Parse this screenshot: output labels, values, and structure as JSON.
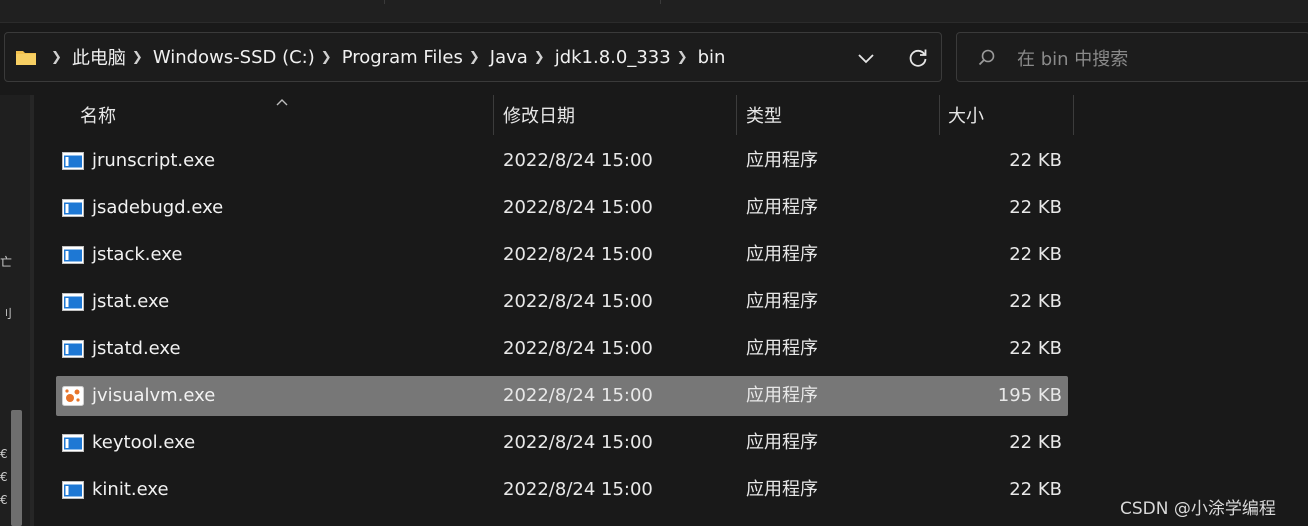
{
  "address_bar": {
    "folder_icon": "folder-icon",
    "breadcrumbs": [
      "此电脑",
      "Windows-SSD (C:)",
      "Program Files",
      "Java",
      "jdk1.8.0_333",
      "bin"
    ],
    "dropdown_icon": "chevron-down-icon",
    "refresh_icon": "refresh-icon"
  },
  "search": {
    "placeholder": "在 bin 中搜索",
    "value": "",
    "icon": "search-icon"
  },
  "columns": {
    "name": "名称",
    "date": "修改日期",
    "type": "类型",
    "size": "大小",
    "sort_indicator": "chevron-up-icon"
  },
  "files": [
    {
      "name": "jrunscript.exe",
      "date": "2022/8/24 15:00",
      "type": "应用程序",
      "size": "22 KB",
      "icon": "exe-window-icon",
      "selected": false
    },
    {
      "name": "jsadebugd.exe",
      "date": "2022/8/24 15:00",
      "type": "应用程序",
      "size": "22 KB",
      "icon": "exe-window-icon",
      "selected": false
    },
    {
      "name": "jstack.exe",
      "date": "2022/8/24 15:00",
      "type": "应用程序",
      "size": "22 KB",
      "icon": "exe-window-icon",
      "selected": false
    },
    {
      "name": "jstat.exe",
      "date": "2022/8/24 15:00",
      "type": "应用程序",
      "size": "22 KB",
      "icon": "exe-window-icon",
      "selected": false
    },
    {
      "name": "jstatd.exe",
      "date": "2022/8/24 15:00",
      "type": "应用程序",
      "size": "22 KB",
      "icon": "exe-window-icon",
      "selected": false
    },
    {
      "name": "jvisualvm.exe",
      "date": "2022/8/24 15:00",
      "type": "应用程序",
      "size": "195 KB",
      "icon": "visualvm-app-icon",
      "selected": true
    },
    {
      "name": "keytool.exe",
      "date": "2022/8/24 15:00",
      "type": "应用程序",
      "size": "22 KB",
      "icon": "exe-window-icon",
      "selected": false
    },
    {
      "name": "kinit.exe",
      "date": "2022/8/24 15:00",
      "type": "应用程序",
      "size": "22 KB",
      "icon": "exe-window-icon",
      "selected": false
    }
  ],
  "nav_pane_glyphs": [
    "亡",
    "刂",
    "€",
    "€",
    "€"
  ],
  "watermark": "CSDN @小涂学编程",
  "colors": {
    "background": "#191919",
    "selection": "#777777",
    "folder": "#f2c14e",
    "exe_icon_blue": "#1e78d4",
    "visualvm_orange": "#e8742a"
  }
}
